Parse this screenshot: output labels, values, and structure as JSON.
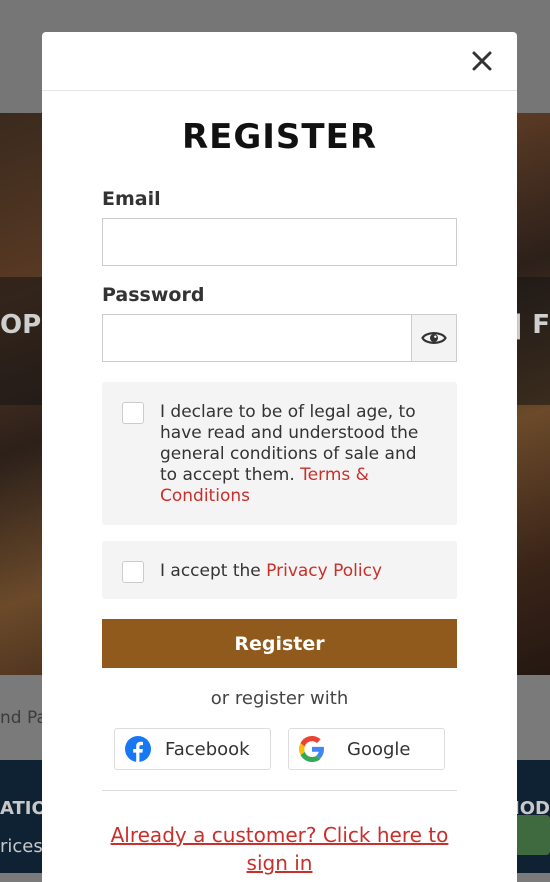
{
  "background": {
    "hero_left": "OPI",
    "hero_right": "| F",
    "strip_text": "nd Pay",
    "footer_left_heading": "ATIO",
    "footer_left_text": "rices",
    "footer_right_heading": "HOD"
  },
  "modal": {
    "title": "REGISTER",
    "email_label": "Email",
    "email_value": "",
    "password_label": "Password",
    "password_value": "",
    "legal": {
      "text": "I declare to be of legal age, to have read and understood the general conditions of sale and to accept them.",
      "link": "Terms & Conditions",
      "checked": false
    },
    "privacy": {
      "text": "I accept the",
      "link": "Privacy Policy",
      "checked": false
    },
    "register_label": "Register",
    "or_text": "or register with",
    "facebook_label": "Facebook",
    "google_label": "Google",
    "signin_link": "Already a customer? Click here to sign in"
  },
  "colors": {
    "accent": "#8f5a1b",
    "link": "#c9302c",
    "facebook": "#1877f2"
  },
  "icons": {
    "close": "close-icon",
    "eye": "eye-icon",
    "facebook": "facebook-icon",
    "google": "google-icon"
  }
}
